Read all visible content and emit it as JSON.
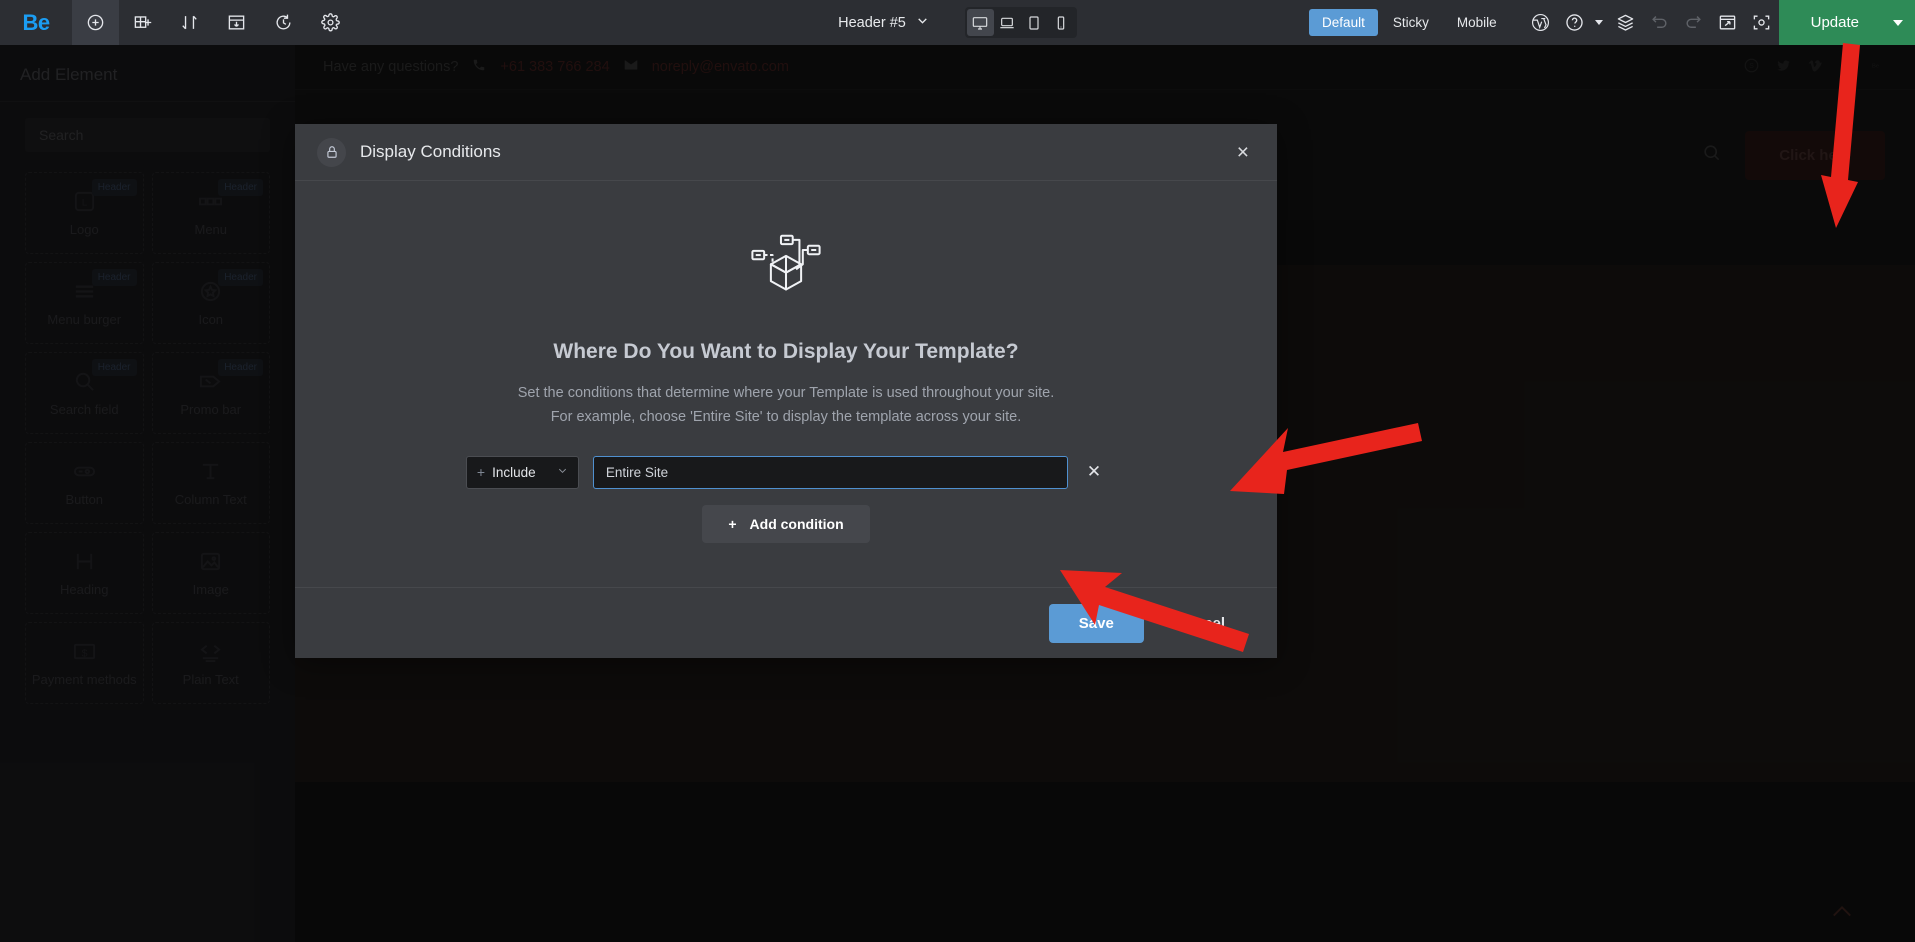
{
  "topbar": {
    "logo": "Be",
    "tools": [
      {
        "name": "add-element-icon",
        "label": "Add Element"
      },
      {
        "name": "add-section-icon",
        "label": "Add Section"
      },
      {
        "name": "reorder-icon",
        "label": "Reorder"
      },
      {
        "name": "layout-icon",
        "label": "Layout"
      },
      {
        "name": "history-icon",
        "label": "History"
      },
      {
        "name": "settings-icon",
        "label": "Settings"
      }
    ],
    "template_name": "Header #5",
    "devices": [
      {
        "name": "desktop",
        "active": true
      },
      {
        "name": "laptop",
        "active": false
      },
      {
        "name": "tablet",
        "active": false
      },
      {
        "name": "mobile",
        "active": false
      }
    ],
    "states": [
      {
        "label": "Default",
        "active": true
      },
      {
        "label": "Sticky",
        "active": false
      },
      {
        "label": "Mobile",
        "active": false
      }
    ],
    "right_icons": [
      {
        "name": "wordpress-icon"
      },
      {
        "name": "help-icon"
      },
      {
        "name": "layers-icon"
      },
      {
        "name": "undo-icon"
      },
      {
        "name": "redo-icon"
      },
      {
        "name": "preview-icon"
      },
      {
        "name": "focus-icon"
      }
    ],
    "update_label": "Update",
    "accent_blue": "#5b9bd5",
    "update_green": "#2e8b57"
  },
  "sidebar": {
    "title": "Add Element",
    "search_placeholder": "Search",
    "elements": [
      {
        "label": "Logo",
        "badge": "Header",
        "icon": "logo-icon"
      },
      {
        "label": "Menu",
        "badge": "Header",
        "icon": "menu-icon"
      },
      {
        "label": "Menu burger",
        "badge": "Header",
        "icon": "burger-icon"
      },
      {
        "label": "Icon",
        "badge": "Header",
        "icon": "star-icon"
      },
      {
        "label": "Search field",
        "badge": "Header",
        "icon": "search-icon"
      },
      {
        "label": "Promo bar",
        "badge": "Header",
        "icon": "tag-icon"
      },
      {
        "label": "Button",
        "badge": "",
        "icon": "button-icon"
      },
      {
        "label": "Column Text",
        "badge": "",
        "icon": "text-icon"
      },
      {
        "label": "Heading",
        "badge": "",
        "icon": "heading-icon"
      },
      {
        "label": "Image",
        "badge": "",
        "icon": "image-icon"
      },
      {
        "label": "Payment methods",
        "badge": "",
        "icon": "payment-icon"
      },
      {
        "label": "Plain Text",
        "badge": "",
        "icon": "code-icon"
      }
    ]
  },
  "canvas": {
    "questions_label": "Have any questions?",
    "phone": "+61 383 766 284",
    "email": "noreply@envato.com",
    "socials": [
      "skype-icon",
      "twitter-icon",
      "vimeo-icon",
      "youtube-icon",
      "behance-icon"
    ],
    "cta_label": "Click here"
  },
  "modal": {
    "title": "Display Conditions",
    "close_label": "×",
    "heading": "Where Do You Want to Display Your Template?",
    "desc_line1": "Set the conditions that determine where your Template is used throughout your site.",
    "desc_line2": "For example, choose 'Entire Site' to display the template across your site.",
    "condition": {
      "type_label": "Include",
      "type_plus": "+",
      "value": "Entire Site",
      "remove_label": "✕"
    },
    "add_condition_label": "Add condition",
    "add_condition_plus": "+",
    "save_label": "Save",
    "cancel_label": "Cancel"
  },
  "annotations": {
    "arrow_color": "#e8241c",
    "arrows": [
      {
        "name": "arrow-to-update-button"
      },
      {
        "name": "arrow-to-condition-input"
      },
      {
        "name": "arrow-to-add-condition"
      }
    ]
  }
}
